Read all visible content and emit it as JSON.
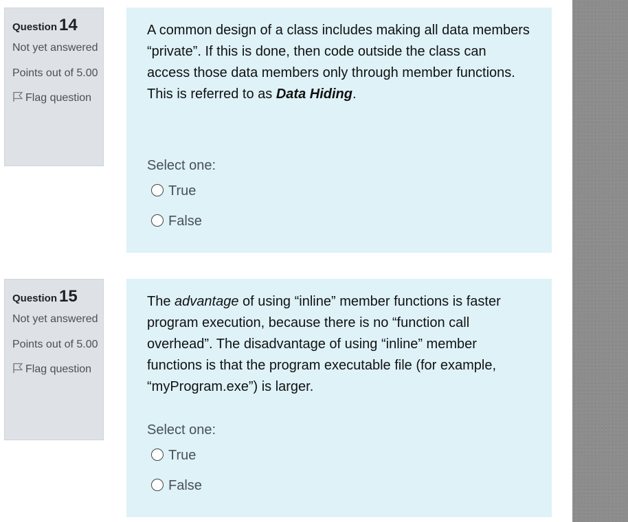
{
  "questions": [
    {
      "label": "Question",
      "number": "14",
      "state": "Not yet answered",
      "grade": "Points out of 5.00",
      "flag": "Flag question",
      "text": {
        "p1": "A common design of a class includes making all data members “private”. If this is done, then code outside the class can access those data members only through member functions. This is referred to as ",
        "bold_italic": "Data Hiding",
        "p2": "."
      },
      "prompt": "Select one:",
      "options": [
        "True",
        "False"
      ]
    },
    {
      "label": "Question",
      "number": "15",
      "state": "Not yet answered",
      "grade": "Points out of 5.00",
      "flag": "Flag question",
      "text": {
        "p1": "The ",
        "italic": "advantage",
        "p2": " of using “inline” member functions is faster program execution, because there is no “function call overhead”. The disadvantage of using “inline” member functions is that the program executable file (for example, “myProgram.exe”) is larger."
      },
      "prompt": "Select one:",
      "options": [
        "True",
        "False"
      ]
    }
  ]
}
